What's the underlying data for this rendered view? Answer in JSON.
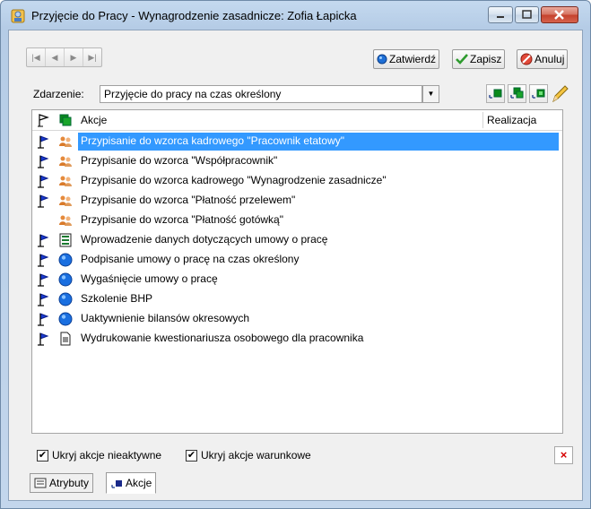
{
  "window": {
    "title": "Przyjęcie do Pracy - Wynagrodzenie zasadnicze:  Zofia Łapicka"
  },
  "toolbar": {
    "nav": [
      "|◀",
      "◀",
      "▶",
      "▶|"
    ],
    "confirm_label": "Zatwierdź",
    "save_label": "Zapisz",
    "cancel_label": "Anuluj"
  },
  "event": {
    "label": "Zdarzenie:",
    "value": "Przyjęcie do pracy na czas określony"
  },
  "list": {
    "columns": {
      "actions": "Akcje",
      "realization": "Realizacja"
    },
    "rows": [
      {
        "text": "Przypisanie do wzorca kadrowego \"Pracownik etatowy\"",
        "flag": true,
        "icon": "people-icon",
        "selected": true
      },
      {
        "text": "Przypisanie do wzorca \"Współpracownik\"",
        "flag": true,
        "icon": "people-icon",
        "selected": false
      },
      {
        "text": "Przypisanie do wzorca kadrowego \"Wynagrodzenie zasadnicze\"",
        "flag": true,
        "icon": "people-icon",
        "selected": false
      },
      {
        "text": "Przypisanie do wzorca \"Płatność przelewem\"",
        "flag": true,
        "icon": "people-icon",
        "selected": false
      },
      {
        "text": "Przypisanie do wzorca \"Płatność gotówką\"",
        "flag": false,
        "icon": "people-icon",
        "selected": false
      },
      {
        "text": "Wprowadzenie danych dotyczących umowy o pracę",
        "flag": true,
        "icon": "form-icon",
        "selected": false
      },
      {
        "text": "Podpisanie umowy o pracę na czas określony",
        "flag": true,
        "icon": "info-circle-icon",
        "selected": false
      },
      {
        "text": "Wygaśnięcie umowy o pracę",
        "flag": true,
        "icon": "info-circle-icon",
        "selected": false
      },
      {
        "text": "Szkolenie BHP",
        "flag": true,
        "icon": "info-circle-icon",
        "selected": false
      },
      {
        "text": "Uaktywnienie bilansów okresowych",
        "flag": true,
        "icon": "info-circle-icon",
        "selected": false
      },
      {
        "text": "Wydrukowanie kwestionariusza osobowego dla pracownika",
        "flag": true,
        "icon": "document-icon",
        "selected": false
      }
    ]
  },
  "options": {
    "hide_inactive_label": "Ukryj akcje nieaktywne",
    "hide_inactive_checked": true,
    "hide_conditional_label": "Ukryj akcje warunkowe",
    "hide_conditional_checked": true,
    "clear_label": "×"
  },
  "tabs": [
    {
      "label": "Atrybuty",
      "active": false
    },
    {
      "label": "Akcje",
      "active": true
    }
  ],
  "colors": {
    "selection": "#3399ff",
    "close_button": "#c4412c",
    "confirm_icon": "#1e6fd6",
    "save_icon": "#2e9b2e",
    "cancel_icon": "#d83a2a"
  }
}
